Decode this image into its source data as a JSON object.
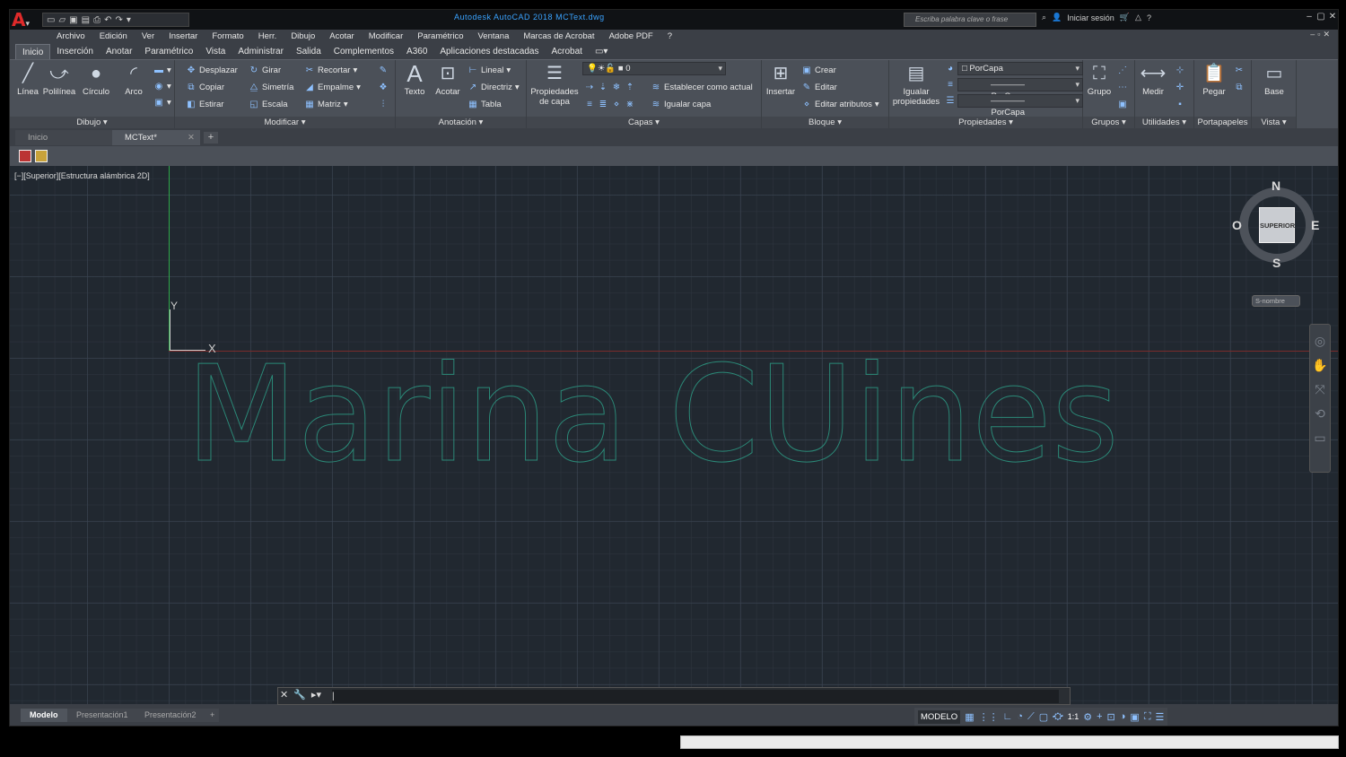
{
  "app": {
    "logo": "A",
    "title": "Autodesk AutoCAD 2018    MCText.dwg",
    "search_placeholder": "Escriba palabra clave o frase",
    "login_label": "Iniciar sesión"
  },
  "menubar": [
    "Archivo",
    "Edición",
    "Ver",
    "Insertar",
    "Formato",
    "Herr.",
    "Dibujo",
    "Acotar",
    "Modificar",
    "Paramétrico",
    "Ventana",
    "Marcas de Acrobat",
    "Adobe PDF",
    "?"
  ],
  "ribbon_tabs": [
    "Inicio",
    "Inserción",
    "Anotar",
    "Paramétrico",
    "Vista",
    "Administrar",
    "Salida",
    "Complementos",
    "A360",
    "Aplicaciones destacadas",
    "Acrobat"
  ],
  "ribbon": {
    "dibujo": {
      "label": "Dibujo",
      "linea": "Línea",
      "polilinea": "Polilínea",
      "circulo": "Círculo",
      "arco": "Arco"
    },
    "modificar": {
      "label": "Modificar",
      "desplazar": "Desplazar",
      "girar": "Girar",
      "recortar": "Recortar",
      "copiar": "Copiar",
      "simetria": "Simetría",
      "empalme": "Empalme",
      "estirar": "Estirar",
      "escala": "Escala",
      "matriz": "Matriz"
    },
    "anotacion": {
      "label": "Anotación",
      "texto": "Texto",
      "acotar": "Acotar",
      "lineal": "Lineal",
      "directriz": "Directriz",
      "tabla": "Tabla"
    },
    "capas": {
      "label": "Capas",
      "propiedades": "Propiedades de capa",
      "layer_value": "0",
      "establecer": "Establecer como actual",
      "igualar": "Igualar capa"
    },
    "bloque": {
      "label": "Bloque",
      "insertar": "Insertar",
      "crear": "Crear",
      "editar": "Editar",
      "editar_atributos": "Editar atributos"
    },
    "propiedades": {
      "label": "Propiedades",
      "igualar": "Igualar propiedades",
      "color": "PorCapa",
      "linetype": "PorCapa",
      "lineweight": "PorCapa"
    },
    "grupos": {
      "label": "Grupos",
      "grupo": "Grupo"
    },
    "utilidades": {
      "label": "Utilidades",
      "medir": "Medir"
    },
    "portapapeles": {
      "label": "Portapapeles",
      "pegar": "Pegar"
    },
    "vista": {
      "label": "Vista",
      "base": "Base"
    }
  },
  "doc_tabs": [
    "Inicio",
    "MCText*"
  ],
  "viewport": {
    "label": "[−][Superior][Estructura alámbrica 2D]",
    "axis_y": "Y",
    "axis_x": "X",
    "drawing_text": "Marina CUines"
  },
  "viewcube": {
    "n": "N",
    "s": "S",
    "e": "E",
    "w": "O",
    "face": "SUPERIOR",
    "wcs": "S-nombre"
  },
  "layout_tabs": [
    "Modelo",
    "Presentación1",
    "Presentación2"
  ],
  "status": {
    "model": "MODELO",
    "scale": "1:1"
  },
  "colors": {
    "accent": "#3aa3ff",
    "drawing_text": "#2b8a78",
    "viewport_bg": "#212830",
    "ui_bg": "#3b3f46"
  }
}
